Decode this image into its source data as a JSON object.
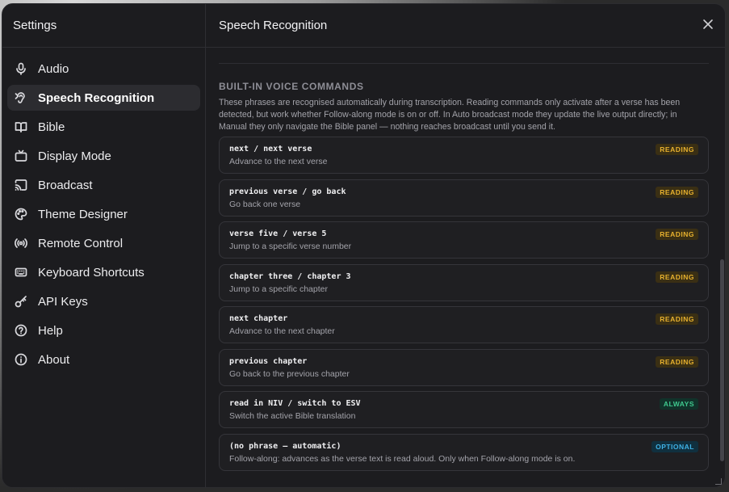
{
  "sidebar": {
    "title": "Settings",
    "items": [
      {
        "label": "Audio",
        "icon": "microphone-icon"
      },
      {
        "label": "Speech Recognition",
        "icon": "ear-icon",
        "active": true
      },
      {
        "label": "Bible",
        "icon": "book-icon"
      },
      {
        "label": "Display Mode",
        "icon": "tv-icon"
      },
      {
        "label": "Broadcast",
        "icon": "cast-icon"
      },
      {
        "label": "Theme Designer",
        "icon": "palette-icon"
      },
      {
        "label": "Remote Control",
        "icon": "radio-icon"
      },
      {
        "label": "Keyboard Shortcuts",
        "icon": "keyboard-icon"
      },
      {
        "label": "API Keys",
        "icon": "key-icon"
      },
      {
        "label": "Help",
        "icon": "help-icon"
      },
      {
        "label": "About",
        "icon": "info-icon"
      }
    ]
  },
  "main": {
    "title": "Speech Recognition",
    "section_title": "BUILT-IN VOICE COMMANDS",
    "section_desc": "These phrases are recognised automatically during transcription. Reading commands only activate after a verse has been detected, but work whether Follow-along mode is on or off. In Auto broadcast mode they update the live output directly; in Manual they only navigate the Bible panel — nothing reaches broadcast until you send it.",
    "commands": [
      {
        "phrase": "next / next verse",
        "desc": "Advance to the next verse",
        "badge": "READING"
      },
      {
        "phrase": "previous verse / go back",
        "desc": "Go back one verse",
        "badge": "READING"
      },
      {
        "phrase": "verse five / verse 5",
        "desc": "Jump to a specific verse number",
        "badge": "READING"
      },
      {
        "phrase": "chapter three / chapter 3",
        "desc": "Jump to a specific chapter",
        "badge": "READING"
      },
      {
        "phrase": "next chapter",
        "desc": "Advance to the next chapter",
        "badge": "READING"
      },
      {
        "phrase": "previous chapter",
        "desc": "Go back to the previous chapter",
        "badge": "READING"
      },
      {
        "phrase": "read in NIV / switch to ESV",
        "desc": "Switch the active Bible translation",
        "badge": "ALWAYS"
      },
      {
        "phrase": "(no phrase — automatic)",
        "desc": "Follow-along: advances as the verse text is read aloud. Only when Follow-along mode is on.",
        "badge": "OPTIONAL"
      }
    ]
  },
  "colors": {
    "reading": "#e7b12e",
    "always": "#3fc88e",
    "optional": "#3fb2e6"
  }
}
